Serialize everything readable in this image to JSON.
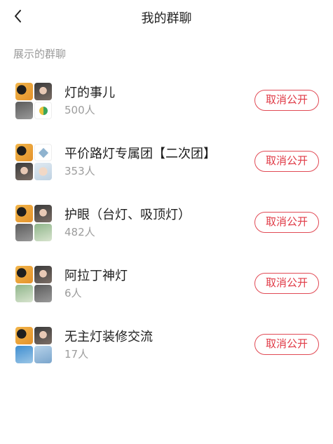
{
  "header": {
    "title": "我的群聊",
    "back_icon": "chevron-left-icon"
  },
  "section": {
    "label": "展示的群聊"
  },
  "groups": [
    {
      "name": "灯的事儿",
      "count": "500人",
      "action_label": "取消公开",
      "avatars": [
        "t-warm",
        "t-face",
        "t-dark",
        "t-yin"
      ]
    },
    {
      "name": "平价路灯专属团【二次团】",
      "count": "353人",
      "action_label": "取消公开",
      "avatars": [
        "t-warm",
        "t-diamond",
        "t-face",
        "t-baby"
      ]
    },
    {
      "name": "护眼（台灯、吸顶灯）",
      "count": "482人",
      "action_label": "取消公开",
      "avatars": [
        "t-warm",
        "t-face",
        "t-dark",
        "t-green"
      ]
    },
    {
      "name": "阿拉丁神灯",
      "count": "6人",
      "action_label": "取消公开",
      "avatars": [
        "t-warm",
        "t-face",
        "t-green",
        "t-dark"
      ]
    },
    {
      "name": "无主灯装修交流",
      "count": "17人",
      "action_label": "取消公开",
      "avatars": [
        "t-warm",
        "t-face",
        "t-blue2",
        "t-blue"
      ]
    }
  ],
  "colors": {
    "accent": "#e03a46",
    "muted_text": "#9c9c9c"
  }
}
